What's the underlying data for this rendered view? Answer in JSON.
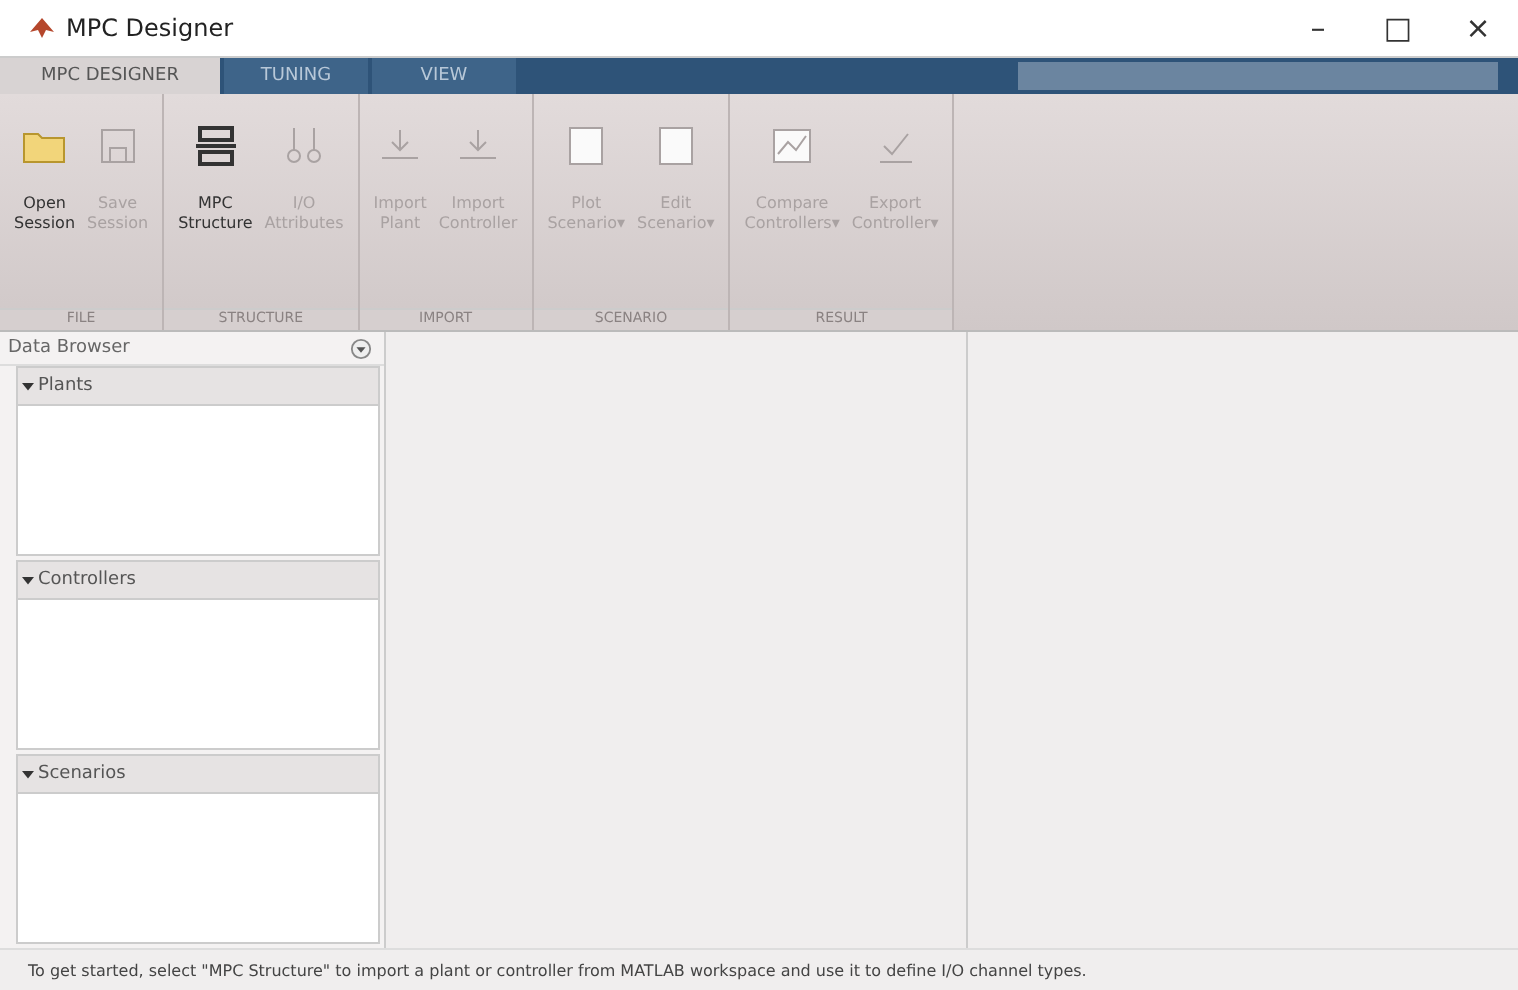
{
  "window": {
    "title": "MPC Designer",
    "controls": [
      "–",
      "□",
      "×"
    ]
  },
  "tabs": [
    {
      "label": "MPC DESIGNER",
      "selected": true
    },
    {
      "label": "TUNING",
      "selected": false
    },
    {
      "label": "VIEW",
      "selected": false
    }
  ],
  "toolbar": [
    {
      "section": "FILE",
      "buttons": [
        {
          "lines": [
            "Open",
            "Session"
          ],
          "disabled": false
        },
        {
          "lines": [
            "Save",
            "Session"
          ],
          "disabled": true
        }
      ]
    },
    {
      "section": "STRUCTURE",
      "buttons": [
        {
          "lines": [
            "MPC",
            "Structure"
          ],
          "disabled": false
        },
        {
          "lines": [
            "I/O",
            "Attributes"
          ],
          "disabled": true
        }
      ]
    },
    {
      "section": "IMPORT",
      "buttons": [
        {
          "lines": [
            "Import",
            "Plant"
          ],
          "disabled": true
        },
        {
          "lines": [
            "Import",
            "Controller"
          ],
          "disabled": true
        }
      ]
    },
    {
      "section": "SCENARIO",
      "buttons": [
        {
          "lines": [
            "Plot",
            "Scenario"
          ],
          "disabled": true,
          "caret": "▾"
        },
        {
          "lines": [
            "Edit",
            "Scenario"
          ],
          "disabled": true,
          "caret": "▾"
        }
      ]
    },
    {
      "section": "RESULT",
      "buttons": [
        {
          "lines": [
            "Compare",
            "Controllers"
          ],
          "disabled": true,
          "caret": "▾"
        },
        {
          "lines": [
            "Export",
            "Controller"
          ],
          "disabled": true,
          "caret": "▾"
        }
      ]
    }
  ],
  "data_browser": {
    "title": "Data Browser",
    "sections": [
      {
        "label": "Plants",
        "expanded": true
      },
      {
        "label": "Controllers",
        "expanded": true
      },
      {
        "label": "Scenarios",
        "expanded": true
      }
    ]
  },
  "status_bar": "To get started, select \"MPC Structure\" to import a plant or controller from MATLAB workspace and use it to define I/O channel types."
}
